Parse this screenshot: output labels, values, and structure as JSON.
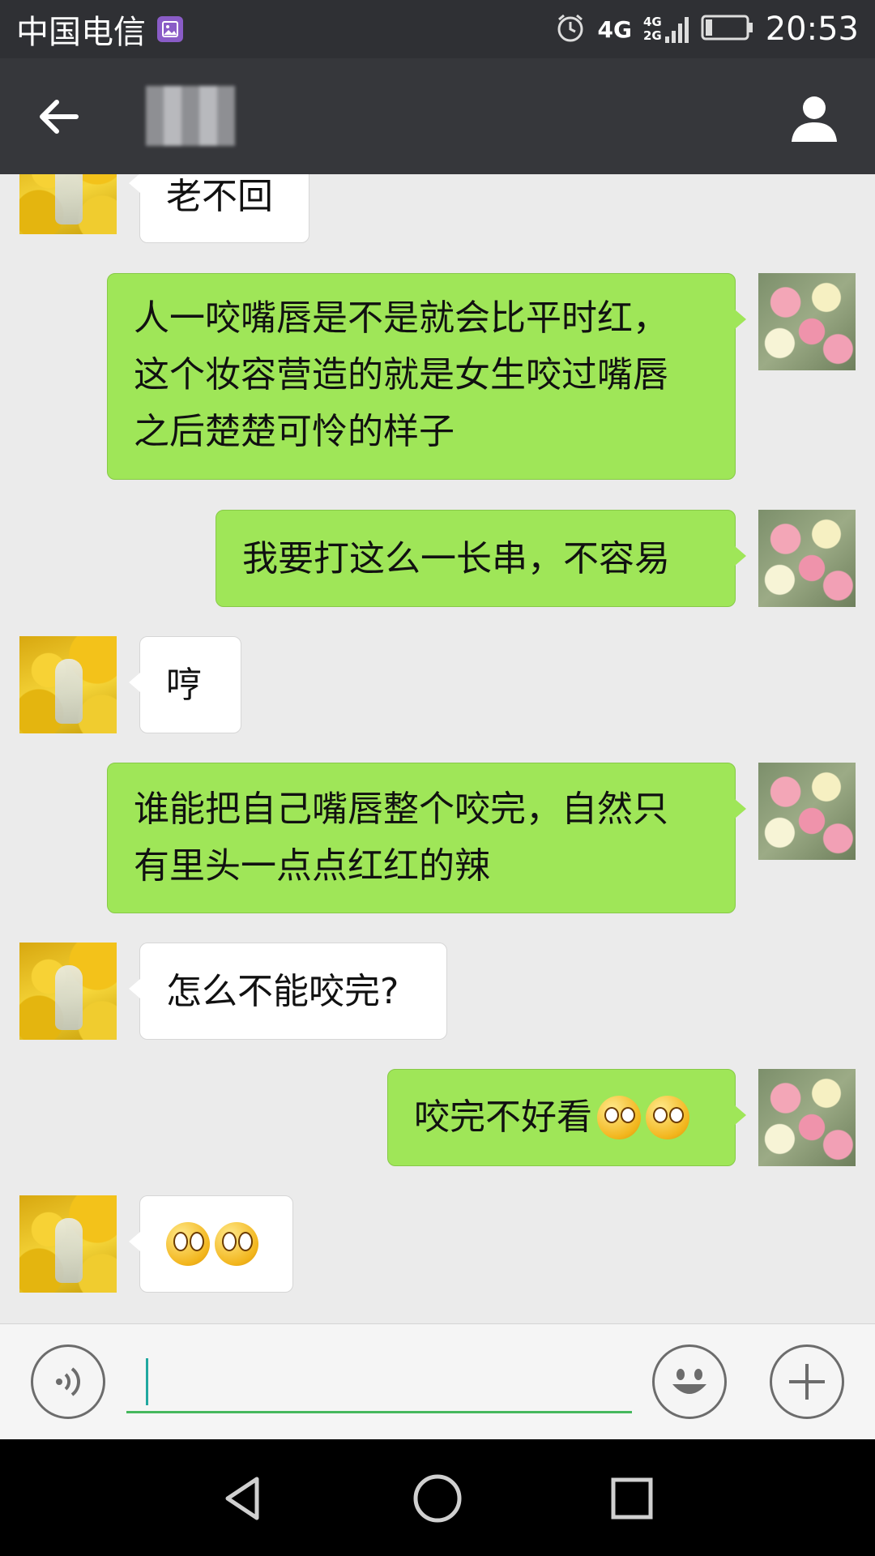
{
  "status_bar": {
    "carrier": "中国电信",
    "network_primary": "4G",
    "network_secondary_top": "4G",
    "network_secondary_bottom": "2G",
    "time": "20:53",
    "icons": [
      "image-notification-icon",
      "alarm-icon",
      "signal-icon",
      "battery-icon"
    ]
  },
  "header": {
    "contact_name_blurred": true,
    "icons": [
      "back-arrow-icon",
      "profile-icon"
    ]
  },
  "messages": [
    {
      "side": "left",
      "text": "老不回"
    },
    {
      "side": "right",
      "lines": [
        "人一咬嘴唇是不是就会比平时红，",
        "这个妆容营造的就是女生咬过嘴唇",
        "之后楚楚可怜的样子"
      ]
    },
    {
      "side": "right",
      "text": "我要打这么一长串，不容易"
    },
    {
      "side": "left",
      "text": "哼"
    },
    {
      "side": "right",
      "lines": [
        "谁能把自己嘴唇整个咬完，自然只",
        "有里头一点点红红的辣"
      ]
    },
    {
      "side": "left",
      "text": "怎么不能咬完?"
    },
    {
      "side": "right",
      "text": "咬完不好看",
      "emoji": [
        "smirk-emoji",
        "smirk-emoji"
      ]
    },
    {
      "side": "left",
      "emoji": [
        "flushed-emoji",
        "flushed-emoji"
      ]
    }
  ],
  "input_bar": {
    "value": "",
    "icons": [
      "voice-icon",
      "emoji-icon",
      "plus-icon"
    ]
  },
  "nav_bar": {
    "icons": [
      "back-triangle-icon",
      "home-circle-icon",
      "recents-square-icon"
    ]
  },
  "colors": {
    "header_bg": "#36373b",
    "chat_bg": "#ebebeb",
    "sent_bubble": "#9fe658",
    "received_bubble": "#ffffff",
    "input_underline": "#45b85d"
  }
}
